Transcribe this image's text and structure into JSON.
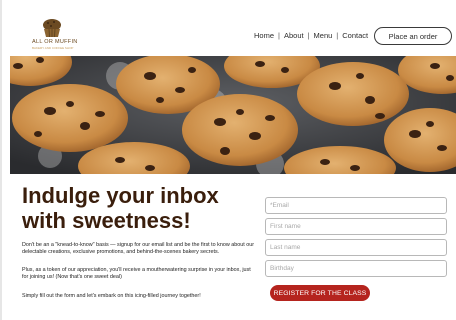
{
  "brand": {
    "name": "ALL OR MUFFIN",
    "tagline": "BAKERY AND COFFEE SHOP"
  },
  "nav": {
    "items": [
      "Home",
      "About",
      "Menu",
      "Contact"
    ],
    "separator": "|",
    "cta_label": "Place an order"
  },
  "hero": {
    "icon": "chocolate-chip-cookies-photo"
  },
  "content": {
    "headline_line1": "Indulge your inbox",
    "headline_line2": "with sweetness!",
    "paragraphs": [
      "Don't be an a \"knead-to-know\" basis — signup for our email list and be the first to know about our delectable creations, exclusive promotions, and behind-the-scenes bakery secrets.",
      "Plus, as a token of our appreciation, you'll receive a moutherwatering surprise in your inbox, just for joining us! (Now that's one sweet deal)",
      "Simply fill out the form and let's embark on this icing-filled journey together!"
    ]
  },
  "form": {
    "email_placeholder": "*Email",
    "first_name_placeholder": "First name",
    "last_name_placeholder": "Last name",
    "birthday_placeholder": "Birthday",
    "submit_label": "REGISTER FOR THE CLASS"
  },
  "colors": {
    "headline": "#3a1e0c",
    "button": "#b5241e",
    "logo": "#6b4a22"
  }
}
